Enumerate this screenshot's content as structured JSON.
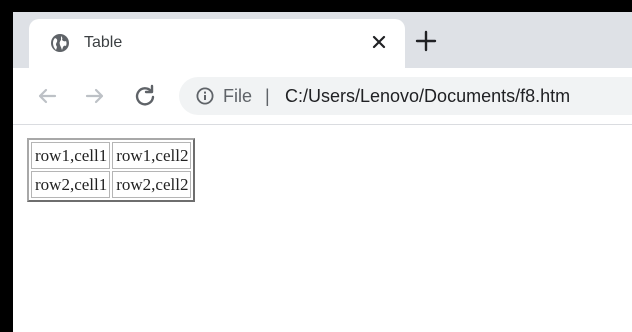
{
  "browser": {
    "tab": {
      "title": "Table",
      "favicon": "globe-icon",
      "close_icon": "close-icon"
    },
    "new_tab_icon": "plus-icon",
    "toolbar": {
      "back_icon": "back-arrow-icon",
      "forward_icon": "forward-arrow-icon",
      "reload_icon": "reload-icon",
      "site_info_icon": "info-icon",
      "scheme_label": "File",
      "separator": "|",
      "url": "C:/Users/Lenovo/Documents/f8.htm"
    }
  },
  "page": {
    "table": {
      "rows": [
        [
          "row1,cell1",
          "row1,cell2"
        ],
        [
          "row2,cell1",
          "row2,cell2"
        ]
      ]
    }
  },
  "colors": {
    "tabstrip_bg": "#dee1e6",
    "omnibox_bg": "#f1f3f4",
    "frame_border": "#000000"
  }
}
